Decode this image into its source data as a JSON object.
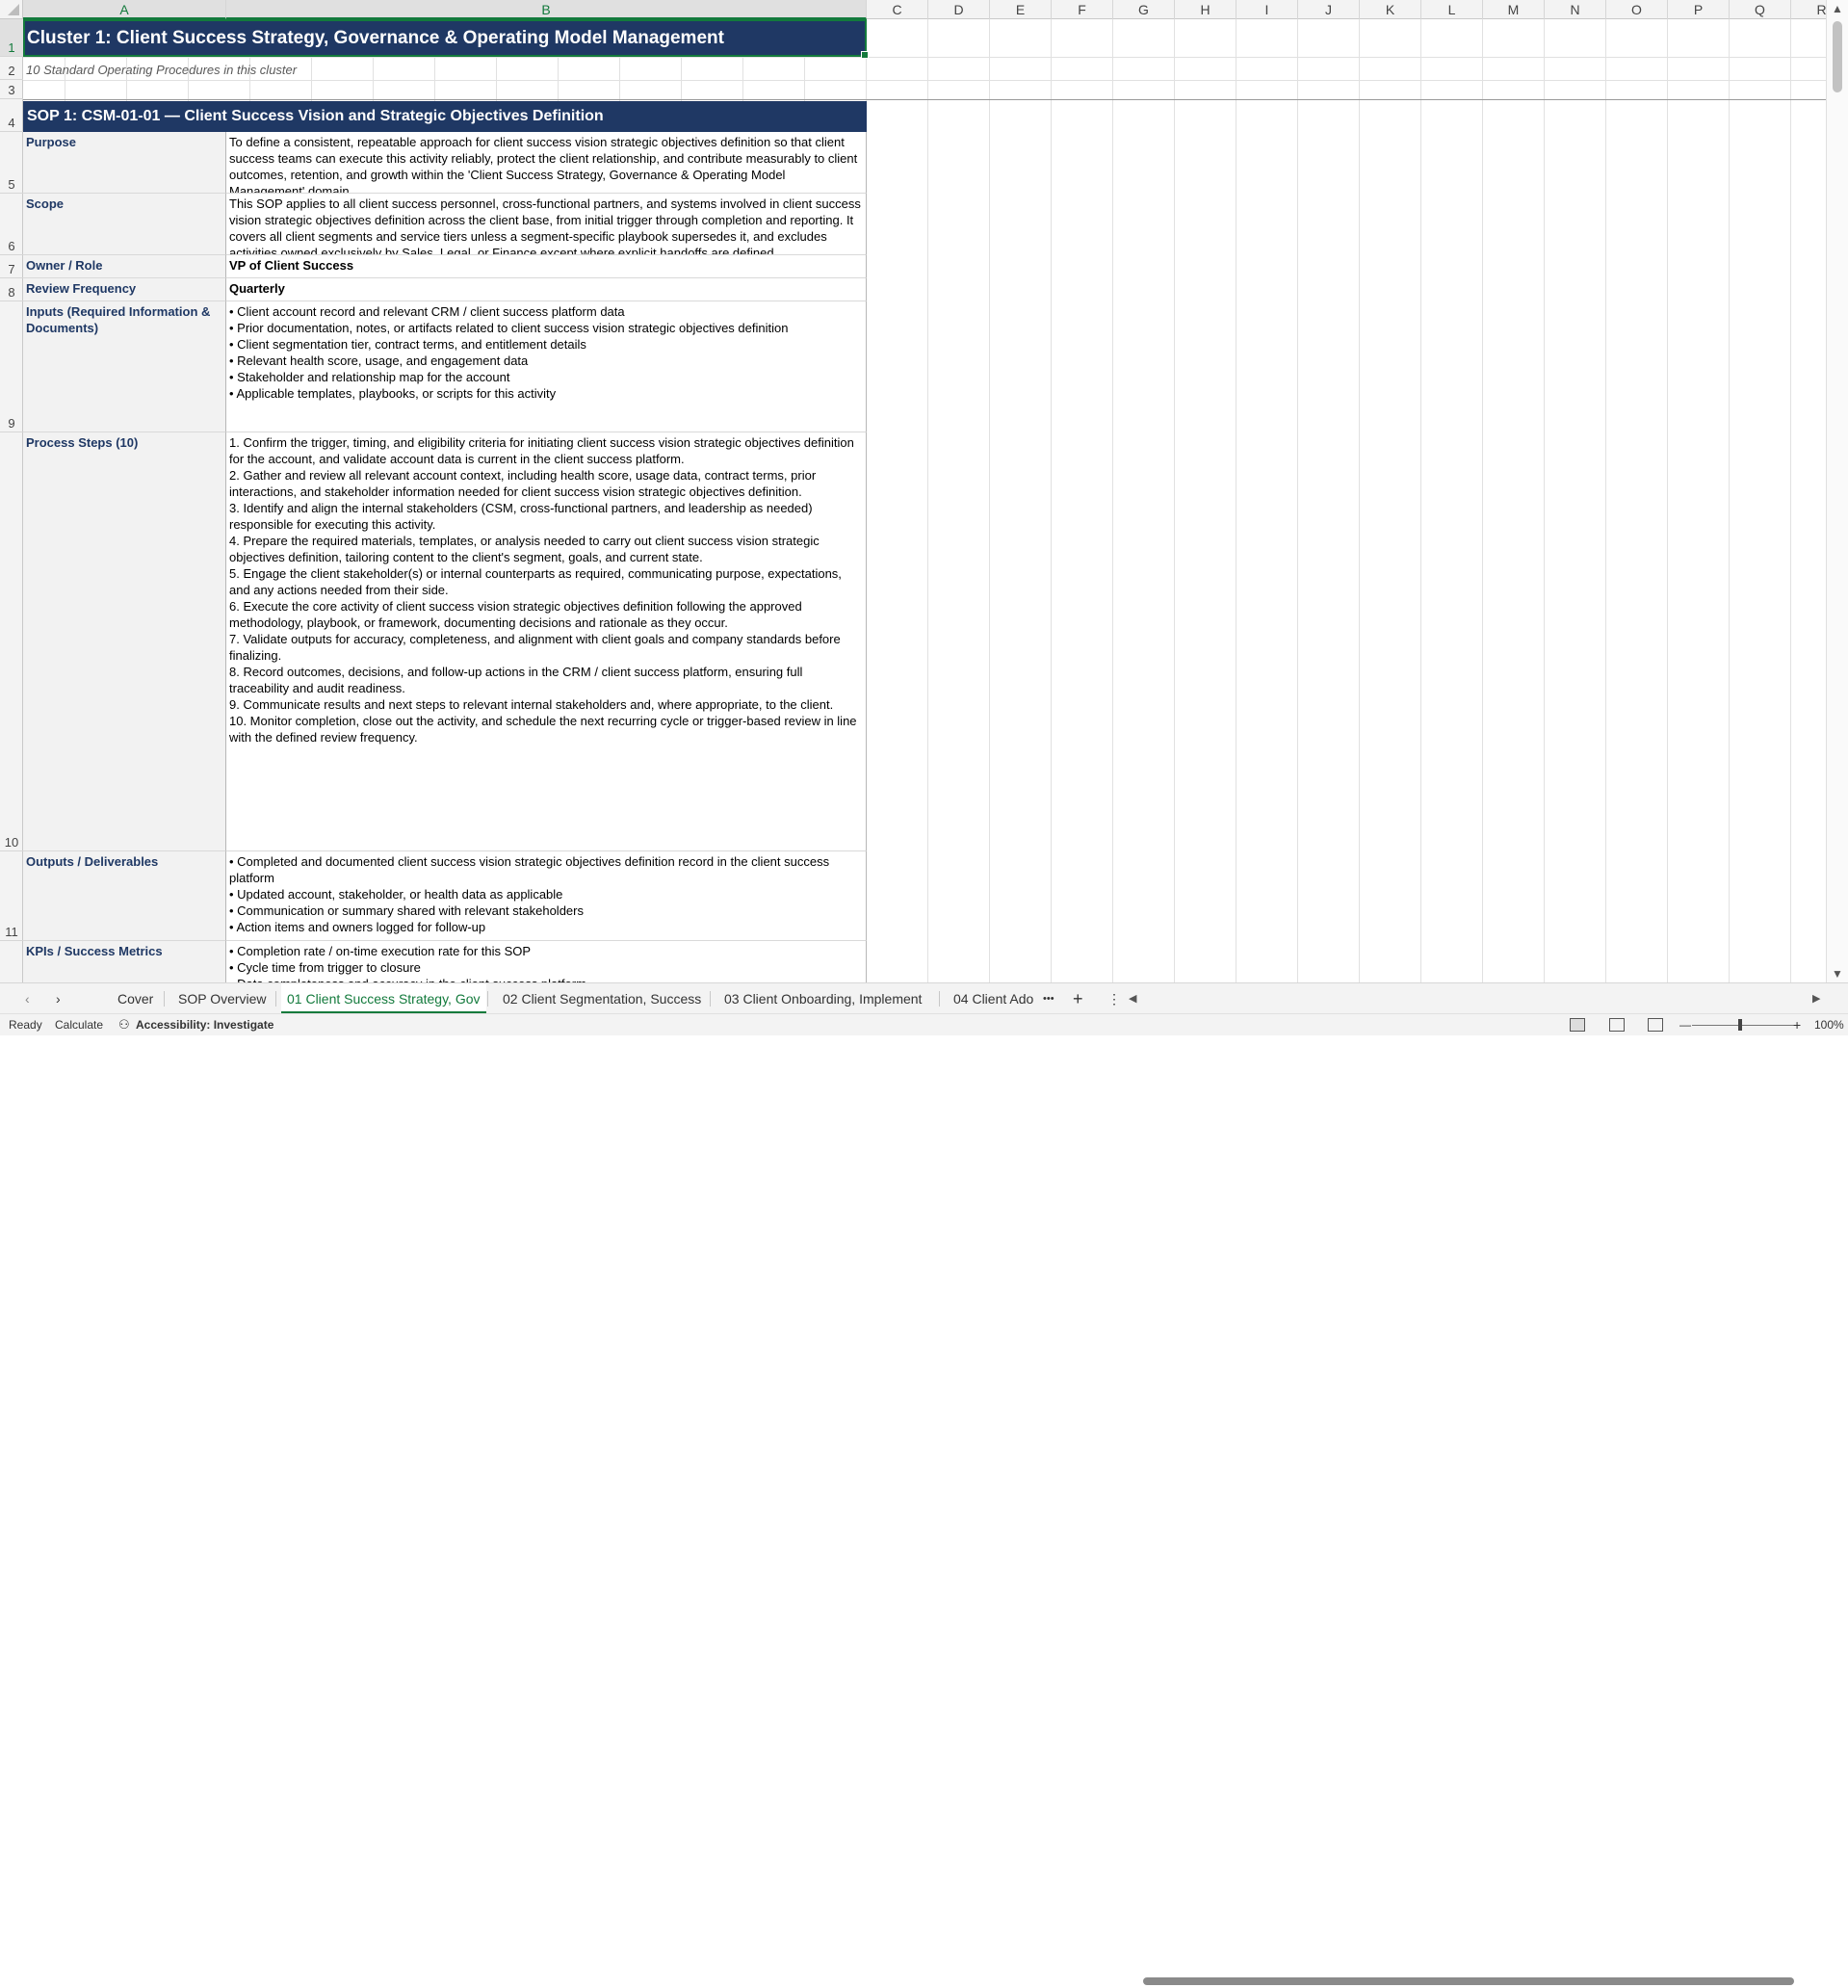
{
  "columns": [
    "A",
    "B",
    "C",
    "D",
    "E",
    "F",
    "G",
    "H",
    "I",
    "J",
    "K",
    "L",
    "M",
    "N",
    "O",
    "P",
    "Q",
    "R"
  ],
  "rows": [
    "1",
    "2",
    "3",
    "4",
    "5",
    "6",
    "7",
    "8",
    "9",
    "10",
    "11"
  ],
  "sheet": {
    "title": "Cluster 1: Client Success Strategy, Governance & Operating Model Management",
    "subtitle": "10 Standard Operating Procedures in this cluster",
    "sop_header": "SOP 1:  CSM-01-01  —  Client Success Vision and Strategic Objectives Definition",
    "purpose_label": "Purpose",
    "purpose_text": "To define a consistent, repeatable approach for client success vision strategic objectives definition so that client success teams can execute this activity reliably, protect the client relationship, and contribute measurably to client outcomes, retention, and growth within the 'Client Success Strategy, Governance & Operating Model Management' domain.",
    "scope_label": "Scope",
    "scope_text": "This SOP applies to all client success personnel, cross-functional partners, and systems involved in client success vision strategic objectives definition across the client base, from initial trigger through completion and reporting. It covers all client segments and service tiers unless a segment-specific playbook supersedes it, and excludes activities owned exclusively by Sales, Legal, or Finance except where explicit handoffs are defined.",
    "owner_label": "Owner / Role",
    "owner_value": "VP of Client Success",
    "frequency_label": "Review Frequency",
    "frequency_value": "Quarterly",
    "inputs_label": "Inputs (Required Information & Documents)",
    "inputs_text": "• Client account record and relevant CRM / client success platform data\n• Prior documentation, notes, or artifacts related to client success vision strategic objectives definition\n• Client segmentation tier, contract terms, and entitlement details\n• Relevant health score, usage, and engagement data\n• Stakeholder and relationship map for the account\n• Applicable templates, playbooks, or scripts for this activity",
    "steps_label": "Process Steps (10)",
    "steps_text": "1. Confirm the trigger, timing, and eligibility criteria for initiating client success vision strategic objectives definition for the account, and validate account data is current in the client success platform.\n2. Gather and review all relevant account context, including health score, usage data, contract terms, prior interactions, and stakeholder information needed for client success vision strategic objectives definition.\n3. Identify and align the internal stakeholders (CSM, cross-functional partners, and leadership as needed) responsible for executing this activity.\n4. Prepare the required materials, templates, or analysis needed to carry out client success vision strategic objectives definition, tailoring content to the client's segment, goals, and current state.\n5. Engage the client stakeholder(s) or internal counterparts as required, communicating purpose, expectations, and any actions needed from their side.\n6. Execute the core activity of client success vision strategic objectives definition following the approved methodology, playbook, or framework, documenting decisions and rationale as they occur.\n7. Validate outputs for accuracy, completeness, and alignment with client goals and company standards before finalizing.\n8. Record outcomes, decisions, and follow-up actions in the CRM / client success platform, ensuring full traceability and audit readiness.\n9. Communicate results and next steps to relevant internal stakeholders and, where appropriate, to the client.\n10. Monitor completion, close out the activity, and schedule the next recurring cycle or trigger-based review in line with the defined review frequency.",
    "outputs_label": "Outputs / Deliverables",
    "outputs_text": "• Completed and documented client success vision strategic objectives definition record in the client success platform\n• Updated account, stakeholder, or health data as applicable\n• Communication or summary shared with relevant stakeholders\n• Action items and owners logged for follow-up",
    "kpis_label": "KPIs / Success Metrics",
    "kpis_text": "• Completion rate / on-time execution rate for this SOP\n• Cycle time from trigger to closure\n• Data completeness and accuracy in the client success platform"
  },
  "tabs": {
    "cover": "Cover",
    "overview": "SOP Overview",
    "active": "01 Client Success Strategy, Gov",
    "t02": "02 Client Segmentation, Success",
    "t03": "03 Client Onboarding, Implement",
    "t04": "04 Client Ado",
    "more": "•••",
    "add": "+"
  },
  "status": {
    "ready": "Ready",
    "calculate": "Calculate",
    "accessibility": "Accessibility: Investigate",
    "zoom": "100%",
    "zoom_minus": "—",
    "zoom_plus": "+"
  }
}
